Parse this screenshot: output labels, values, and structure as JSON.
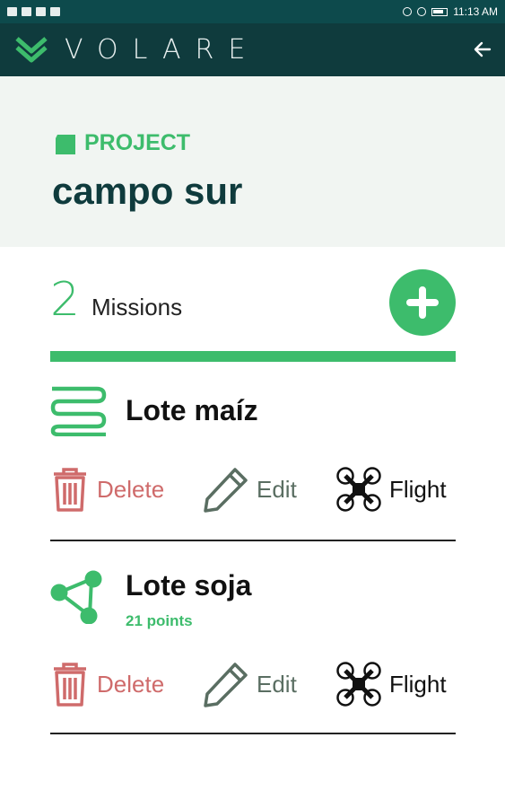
{
  "status_bar": {
    "time": "11:13 AM"
  },
  "app": {
    "brand": "VOLARE"
  },
  "project": {
    "label": "PROJECT",
    "name": "campo sur"
  },
  "missions": {
    "count": "2",
    "label": "Missions",
    "items": [
      {
        "name": "Lote maíz",
        "subtitle": "",
        "icon": "serpentine-path-icon",
        "actions": {
          "delete": "Delete",
          "edit": "Edit",
          "flight": "Flight"
        }
      },
      {
        "name": "Lote soja",
        "subtitle": "21 points",
        "icon": "waypoints-icon",
        "actions": {
          "delete": "Delete",
          "edit": "Edit",
          "flight": "Flight"
        }
      }
    ]
  },
  "colors": {
    "status_bar": "#0d4a4c",
    "app_bar": "#0f3b3d",
    "accent_green": "#3dbc6c",
    "delete_red": "#cf6b6b",
    "edit_gray_green": "#5a6e62",
    "header_bg": "#f1f5f2"
  }
}
